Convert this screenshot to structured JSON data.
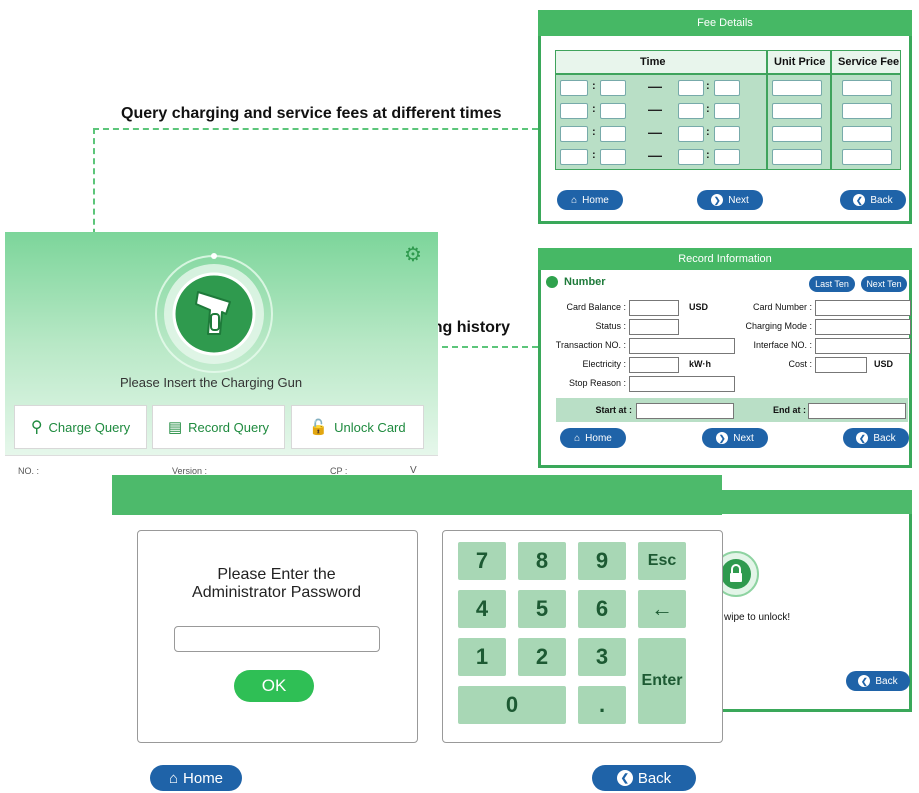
{
  "annotations": {
    "fee_query": "Query charging and service fees at different times",
    "history_query": "Query charging history"
  },
  "fee_details": {
    "title": "Fee Details",
    "columns": [
      "Time",
      "Unit Price",
      "Service Fee"
    ],
    "time_colon": ":",
    "time_dash": "—",
    "rows": 4,
    "buttons": {
      "home": "Home",
      "next": "Next",
      "back": "Back"
    }
  },
  "record_info": {
    "title": "Record Information",
    "number_label": "Number",
    "last_ten": "Last Ten",
    "next_ten": "Next Ten",
    "fields": {
      "card_balance": "Card Balance :",
      "card_balance_unit": "USD",
      "card_number": "Card Number :",
      "status": "Status :",
      "charging_mode": "Charging Mode :",
      "transaction_no": "Transaction NO. :",
      "interface_no": "Interface NO. :",
      "electricity": "Electricity :",
      "electricity_unit": "kW·h",
      "cost": "Cost :",
      "cost_unit": "USD",
      "stop_reason": "Stop Reason :",
      "start_at": "Start at :",
      "end_at": "End at :"
    },
    "buttons": {
      "home": "Home",
      "next": "Next",
      "back": "Back"
    }
  },
  "main_screen": {
    "prompt": "Please Insert the Charging Gun",
    "buttons": {
      "charge_query": "Charge Query",
      "record_query": "Record Query",
      "unlock_card": "Unlock Card"
    },
    "table_headers": [
      "NO. :",
      "Version :",
      "CP :",
      "V"
    ]
  },
  "password": {
    "prompt_line1": "Please Enter the",
    "prompt_line2": "Administrator Password",
    "ok": "OK",
    "keys": [
      "7",
      "8",
      "9",
      "Esc",
      "4",
      "5",
      "6",
      "←",
      "1",
      "2",
      "3",
      "Enter",
      "0",
      "."
    ],
    "home": "Home",
    "back": "Back"
  },
  "unlock": {
    "text": "wipe to unlock!",
    "back": "Back"
  },
  "colors": {
    "green": "#46b865",
    "dark_green": "#1e8a3e",
    "blue": "#1f63a8"
  }
}
